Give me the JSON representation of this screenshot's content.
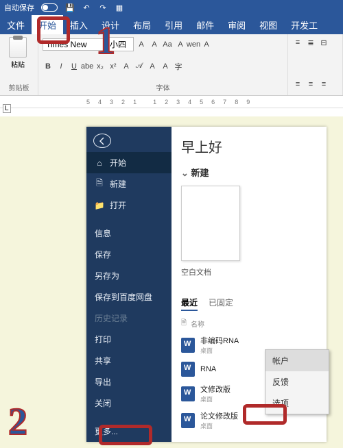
{
  "titlebar": {
    "auto_save": "自动保存"
  },
  "tabs": [
    "文件",
    "开始",
    "插入",
    "设计",
    "布局",
    "引用",
    "邮件",
    "审阅",
    "视图",
    "开发工"
  ],
  "active_tab_index": 1,
  "ribbon": {
    "clipboard": {
      "paste": "粘贴",
      "label": "剪贴板"
    },
    "font": {
      "name": "Times New",
      "size": "小四",
      "btns_row1": [
        "A",
        "A",
        "Aa",
        "A",
        "wen",
        "A"
      ],
      "btns_row2": [
        "B",
        "I",
        "U",
        "abe",
        "x₂",
        "x²",
        "A",
        "𝒜",
        "A",
        "A",
        "字"
      ],
      "label": "字体"
    }
  },
  "ruler": [
    "5",
    "4",
    "3",
    "2",
    "1",
    "",
    "1",
    "2",
    "3",
    "4",
    "5",
    "6",
    "7",
    "8",
    "9"
  ],
  "marker1": "1",
  "marker2": "2",
  "backstage": {
    "nav": [
      {
        "icon": "home",
        "label": "开始",
        "active": true
      },
      {
        "icon": "doc",
        "label": "新建"
      },
      {
        "icon": "folder",
        "label": "打开"
      },
      {
        "sep": true
      },
      {
        "label": "信息"
      },
      {
        "label": "保存"
      },
      {
        "label": "另存为"
      },
      {
        "label": "保存到百度网盘"
      },
      {
        "label": "历史记录",
        "disabled": true
      },
      {
        "label": "打印"
      },
      {
        "label": "共享"
      },
      {
        "label": "导出"
      },
      {
        "label": "关闭"
      },
      {
        "sep": true
      },
      {
        "label": "更多...",
        "hl": true
      }
    ],
    "greeting": "早上好",
    "new_section": "新建",
    "blank_label": "空白文档",
    "recent_tabs": [
      "最近",
      "已固定"
    ],
    "list_header": "名称",
    "docs": [
      {
        "name": "非编码RNA",
        "loc": "桌面"
      },
      {
        "name": "RNA",
        "loc": ""
      },
      {
        "name": "文修改版",
        "loc": "桌面"
      },
      {
        "name": "论文修改版",
        "loc": "桌面"
      }
    ],
    "popup": [
      "帐户",
      "反馈",
      "选项"
    ]
  }
}
